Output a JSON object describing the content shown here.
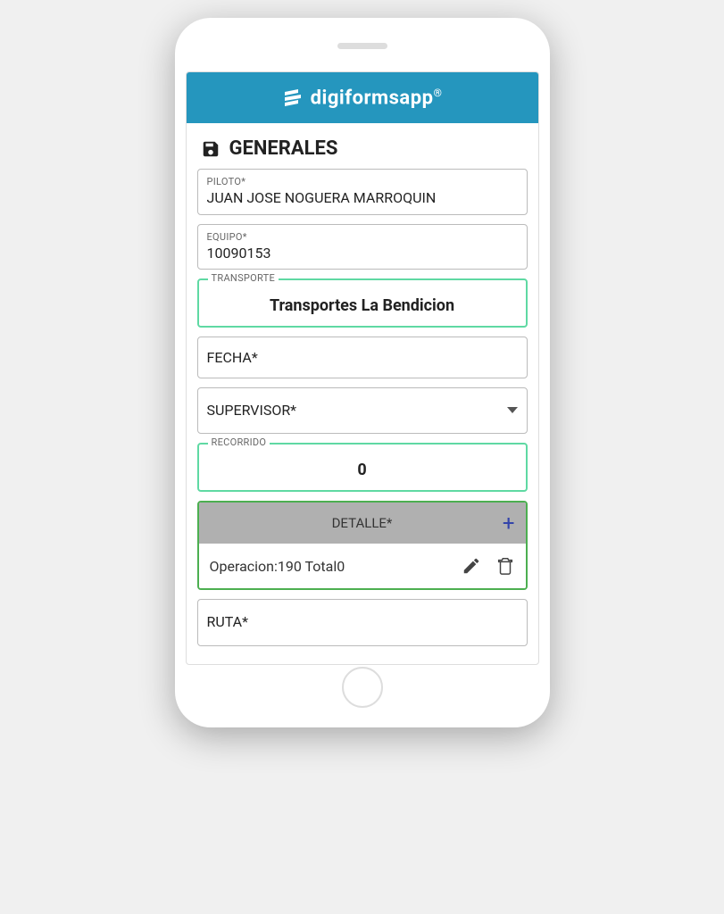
{
  "header": {
    "brand": "digiformsapp",
    "reg": "®"
  },
  "section": {
    "title": "GENERALES"
  },
  "fields": {
    "piloto": {
      "label": "PILOTO*",
      "value": "JUAN JOSE NOGUERA MARROQUIN"
    },
    "equipo": {
      "label": "EQUIPO*",
      "value": "10090153"
    },
    "transporte": {
      "label": "TRANSPORTE",
      "value": "Transportes La Bendicion"
    },
    "fecha": {
      "label": "FECHA*",
      "value": ""
    },
    "supervisor": {
      "label": "SUPERVISOR*",
      "value": ""
    },
    "recorrido": {
      "label": "RECORRIDO",
      "value": "0"
    },
    "ruta": {
      "label": "RUTA*",
      "value": ""
    }
  },
  "detalle": {
    "header": "DETALLE*",
    "row": "Operacion:190 Total0"
  }
}
